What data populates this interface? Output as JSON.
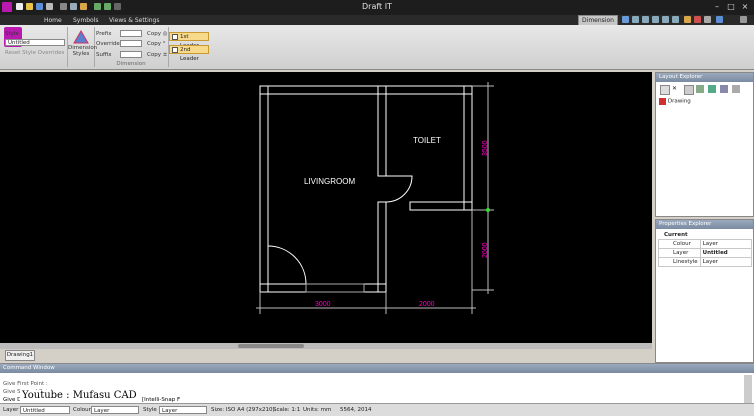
{
  "window": {
    "title": "Draft IT",
    "context_tab": "Dimension"
  },
  "menu": {
    "tabs": [
      "Home",
      "Symbols",
      "Views & Settings"
    ]
  },
  "ribbon": {
    "style_label": "Style",
    "style_value": "Untitled",
    "reset_label": "Reset Style Overrides",
    "dimension_styles_label": "Dimension Styles",
    "prefix_label": "Prefix",
    "override_label": "Override",
    "suffix_label": "Suffix",
    "copy_labels": [
      "Copy ◎",
      "Copy °",
      "Copy ±"
    ],
    "group_label": "Dimension",
    "leader1_label": "1st Leader",
    "leader2_label": "2nd Leader"
  },
  "drawing": {
    "room_labels": {
      "living": "LIVINGROOM",
      "toilet": "TOILET"
    },
    "dims": {
      "bottom_left": "3000",
      "bottom_right": "2000",
      "right_top": "3500",
      "right_bottom": "2000"
    },
    "dim_color": "#ff00c8"
  },
  "doc_tab": "Drawing1",
  "layout_explorer": {
    "title": "Layout Explorer",
    "item": "Drawing"
  },
  "properties_explorer": {
    "title": "Properties Explorer",
    "section": "Current",
    "rows": [
      {
        "name": "Colour",
        "value": "Layer"
      },
      {
        "name": "Layer",
        "value": "Untitled"
      },
      {
        "name": "Linestyle",
        "value": "Layer"
      }
    ]
  },
  "command_window": {
    "title": "Command Window",
    "lines": [
      "Give First Point :",
      "Give Second Point :"
    ],
    "current_prompt": "Give Dim",
    "hint": "[Intelli-Snap F"
  },
  "watermark": "Youtube : Mufasu CAD",
  "status_bar": {
    "layer_label": "Layer",
    "layer_value": "Untitled",
    "colour_label": "Colour",
    "colour_value": "Layer",
    "style_label": "Style",
    "style_value": "Layer",
    "size": "Size: ISO A4 (297x210)",
    "scale": "Scale: 1:1",
    "units": "Units: mm",
    "coords": "5564, 2014"
  }
}
